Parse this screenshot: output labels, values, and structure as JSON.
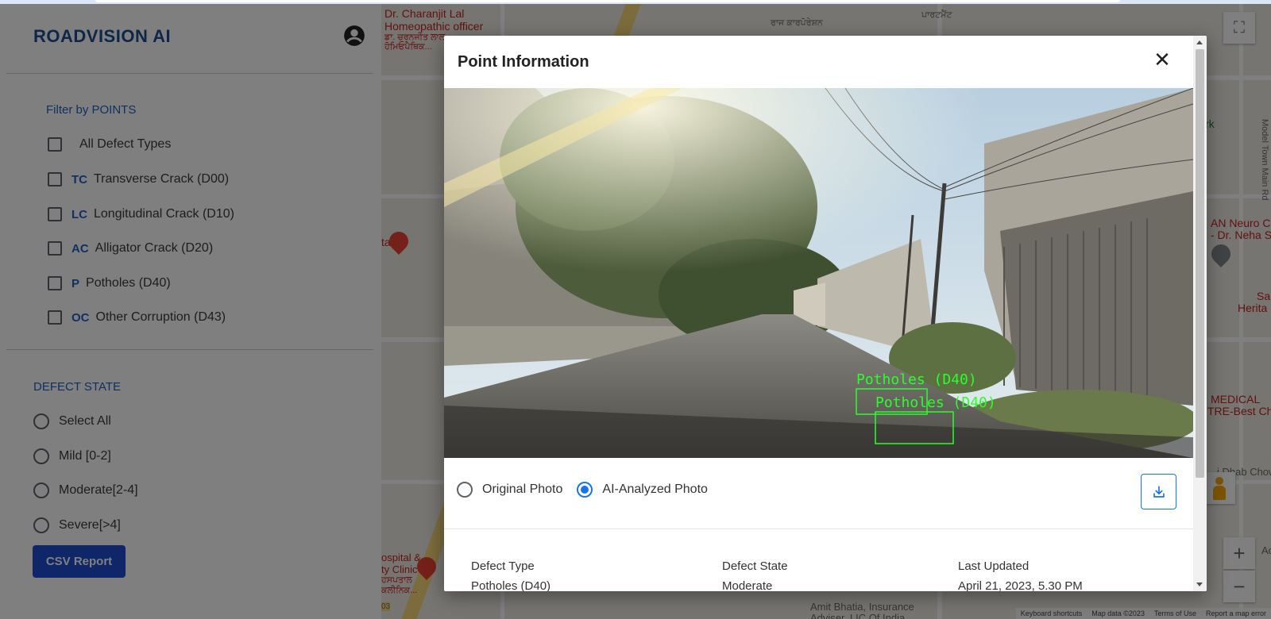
{
  "app": {
    "brand": "ROADVISION AI"
  },
  "filters": {
    "title": "Filter by POINTS",
    "all_label": "All Defect Types",
    "items": [
      {
        "abbr": "TC",
        "label": "Transverse Crack (D00)"
      },
      {
        "abbr": "LC",
        "label": "Longitudinal Crack (D10)"
      },
      {
        "abbr": "AC",
        "label": "Alligator Crack (D20)"
      },
      {
        "abbr": "P",
        "label": "Potholes (D40)"
      },
      {
        "abbr": "OC",
        "label": "Other Corruption (D43)"
      }
    ]
  },
  "defect_state": {
    "title": "DEFECT STATE",
    "options": [
      "Select All",
      "Mild [0-2]",
      "Moderate[2-4]",
      "Severe[>4]"
    ]
  },
  "csv_button": "CSV Report",
  "map": {
    "labels": [
      "Dr. Charanjit Lal",
      "Homeopathic officer",
      "ਡਾ. ਚਰਨਜੀਤ ਲਾਲ",
      "ਹੋਮਿਓਪੈਥਿਕ...",
      "Park",
      "Model Town Main Rd",
      "AN Neuro C",
      "- Dr. Neha S",
      "Sa",
      "Herita",
      "MEDICAL",
      "TRE-Best Che",
      "i Dhab Chow",
      "tal",
      "ospital &",
      "ty Clinic",
      "ਹਸਪਤਾਲ",
      "ਕਲੀਨਿਕ...",
      "Amit Bhatia, Insurance",
      "Adviser, LIC Of India",
      "ਰਾਜ ਕਾਰਪੋਰੇਸ਼ਨ",
      "ਪਾਰਟਮੈਂਟ",
      "03",
      "Ad"
    ],
    "footer": [
      "Keyboard shortcuts",
      "Map data ©2023",
      "Terms of Use",
      "Report a map error"
    ],
    "zoom_in": "+",
    "zoom_out": "−"
  },
  "modal": {
    "title": "Point Information",
    "close_label": "✕",
    "detections": [
      "Potholes (D40)",
      "Potholes (D40)"
    ],
    "photo_options": [
      {
        "label": "Original Photo",
        "selected": false
      },
      {
        "label": "AI-Analyzed Photo",
        "selected": true
      }
    ],
    "info": {
      "defect_type_label": "Defect Type",
      "defect_type_value": "Potholes (D40)",
      "defect_state_label": "Defect State",
      "defect_state_value": "Moderate",
      "last_updated_label": "Last Updated",
      "last_updated_value": "April 21, 2023, 5.30 PM"
    }
  },
  "colors": {
    "brand": "#1c4f91",
    "accent": "#1e62c2",
    "button": "#1e4fd3",
    "detection": "#2aff2a"
  }
}
